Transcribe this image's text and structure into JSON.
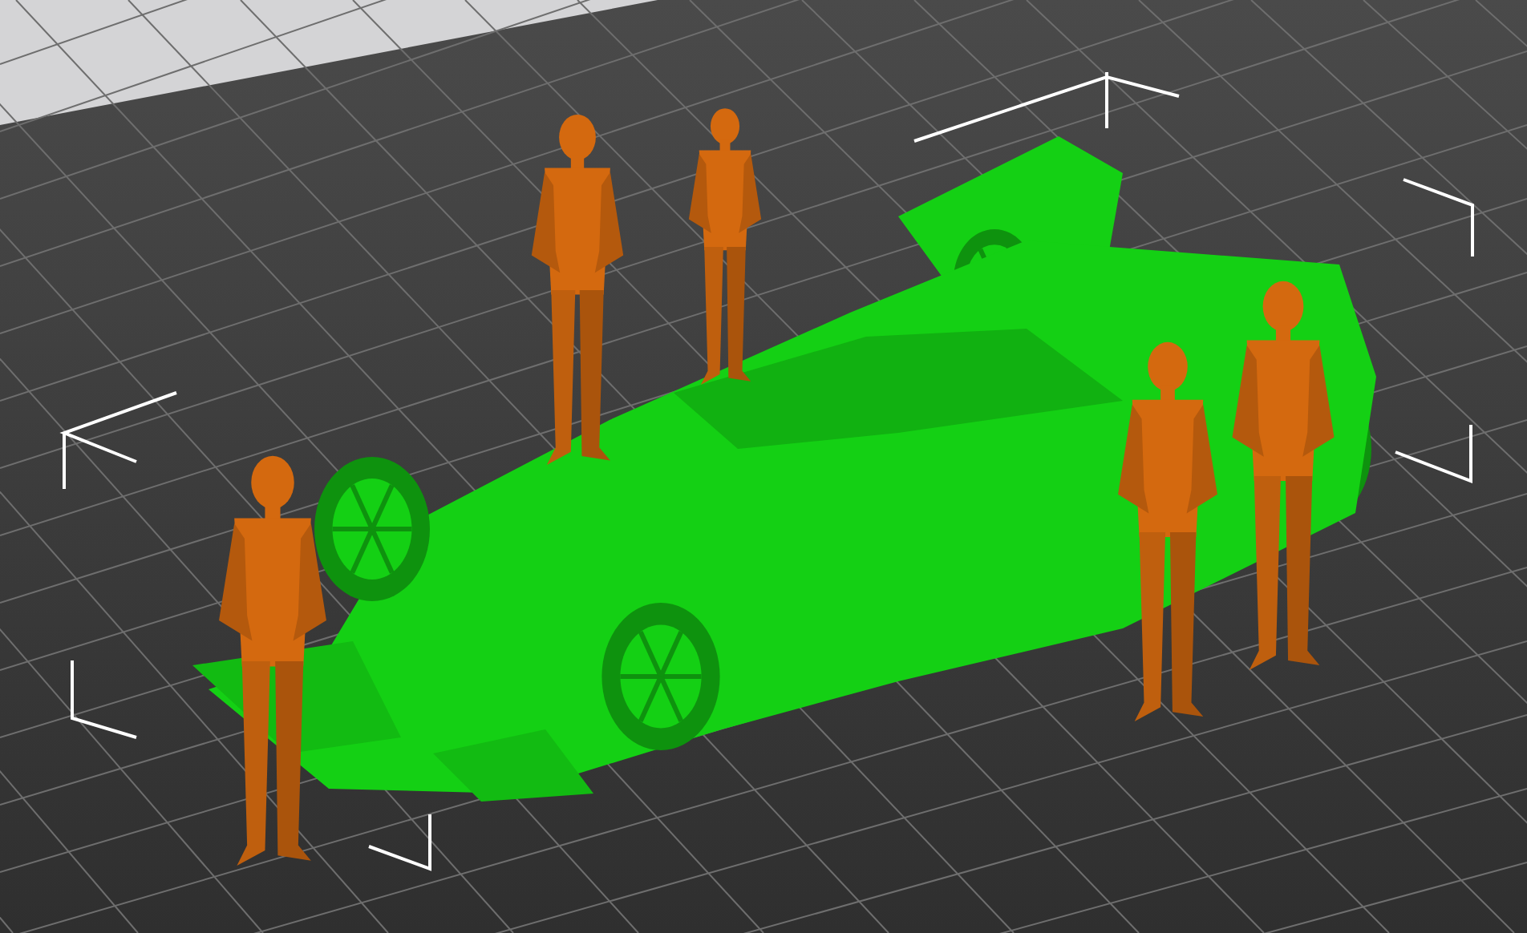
{
  "scene": {
    "models": [
      {
        "kind": "car",
        "color": "#14d014"
      },
      {
        "kind": "figure",
        "color": "#d4690f"
      },
      {
        "kind": "figure",
        "color": "#d4690f"
      },
      {
        "kind": "figure",
        "color": "#d4690f"
      },
      {
        "kind": "figure",
        "color": "#d4690f"
      },
      {
        "kind": "figure",
        "color": "#d4690f"
      }
    ]
  }
}
